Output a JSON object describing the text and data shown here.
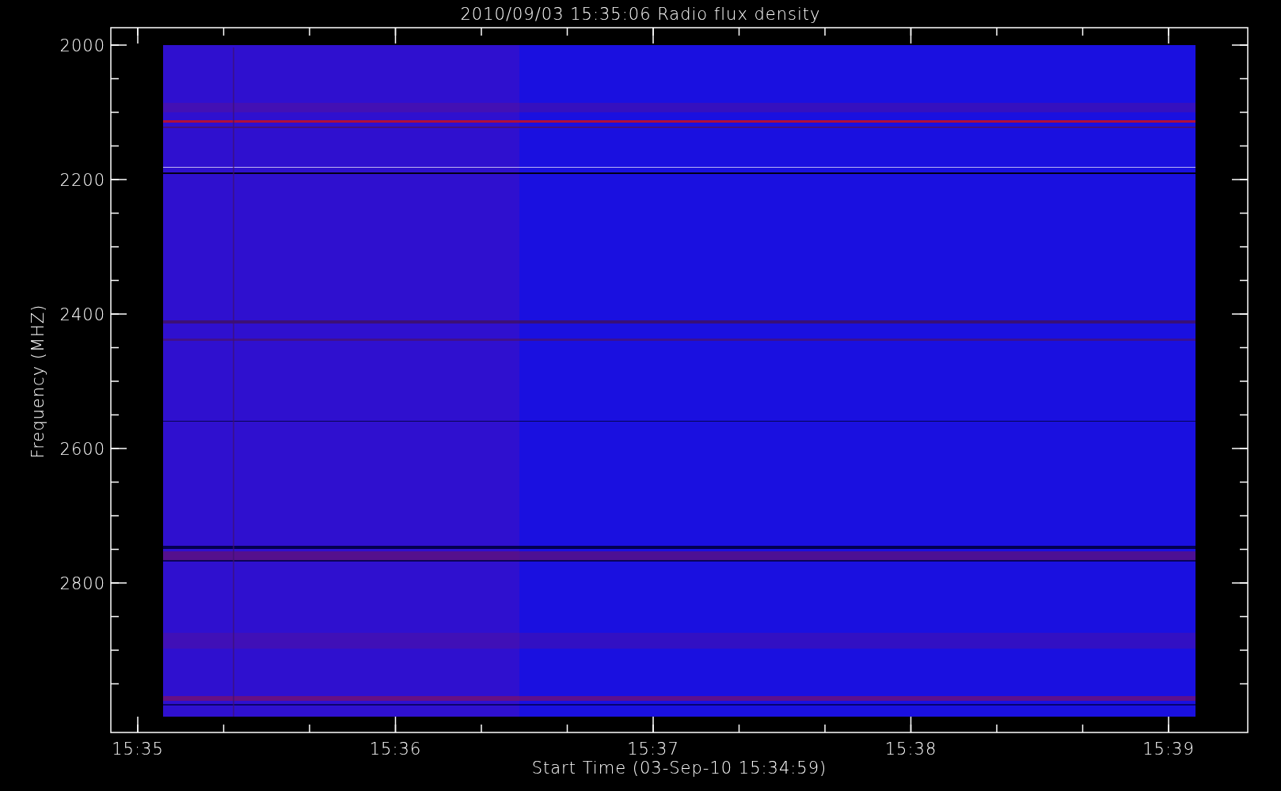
{
  "title": "2010/09/03 15:35:06 Radio flux density",
  "y_axis": {
    "label": "Frequency (MHZ)",
    "ticks": [
      "2000",
      "2200",
      "2400",
      "2600",
      "2800"
    ]
  },
  "x_axis": {
    "label": "Start Time (03-Sep-10 15:34:59)",
    "ticks": [
      "15:35",
      "15:36",
      "15:37",
      "15:38",
      "15:39"
    ]
  }
}
